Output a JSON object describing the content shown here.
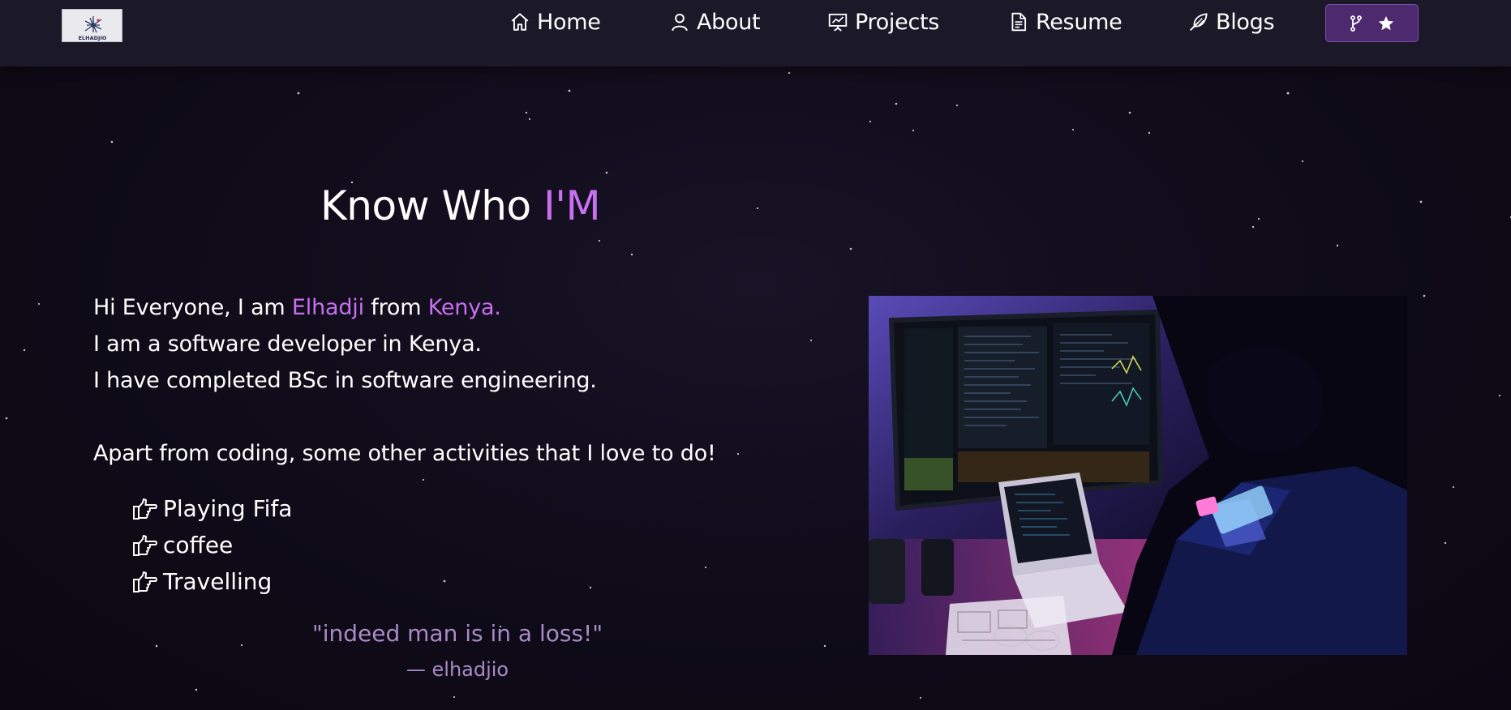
{
  "navbar": {
    "logo_text": "ELHADJIO",
    "items": [
      {
        "label": "Home",
        "icon": "home-icon"
      },
      {
        "label": "About",
        "icon": "user-icon"
      },
      {
        "label": "Projects",
        "icon": "presentation-icon"
      },
      {
        "label": "Resume",
        "icon": "document-icon"
      },
      {
        "label": "Blogs",
        "icon": "feather-pen-icon"
      }
    ],
    "fork_button": {
      "icons": [
        "git-fork-icon",
        "star-icon"
      ]
    }
  },
  "about": {
    "heading_prefix": "Know Who",
    "heading_highlight": "I'M",
    "intro_1": "Hi Everyone, I am",
    "name": "Elhadji",
    "intro_2": "from",
    "country": "Kenya.",
    "line_2": "I am a software developer in Kenya.",
    "line_3": "I have completed BSc in software engineering.",
    "activities_intro": "Apart from coding, some other activities that I love to do!",
    "activities": [
      "Playing Fifa",
      "coffee",
      "Travelling"
    ],
    "quote": "\"indeed man is in a loss!\"",
    "quote_author": "— elhadjio"
  },
  "colors": {
    "accent": "#c770f0",
    "navbar_bg": "#1b1828",
    "page_bg": "#0c0913",
    "button_bg": "#4d2a6e",
    "quote_color": "#a98bc6"
  }
}
